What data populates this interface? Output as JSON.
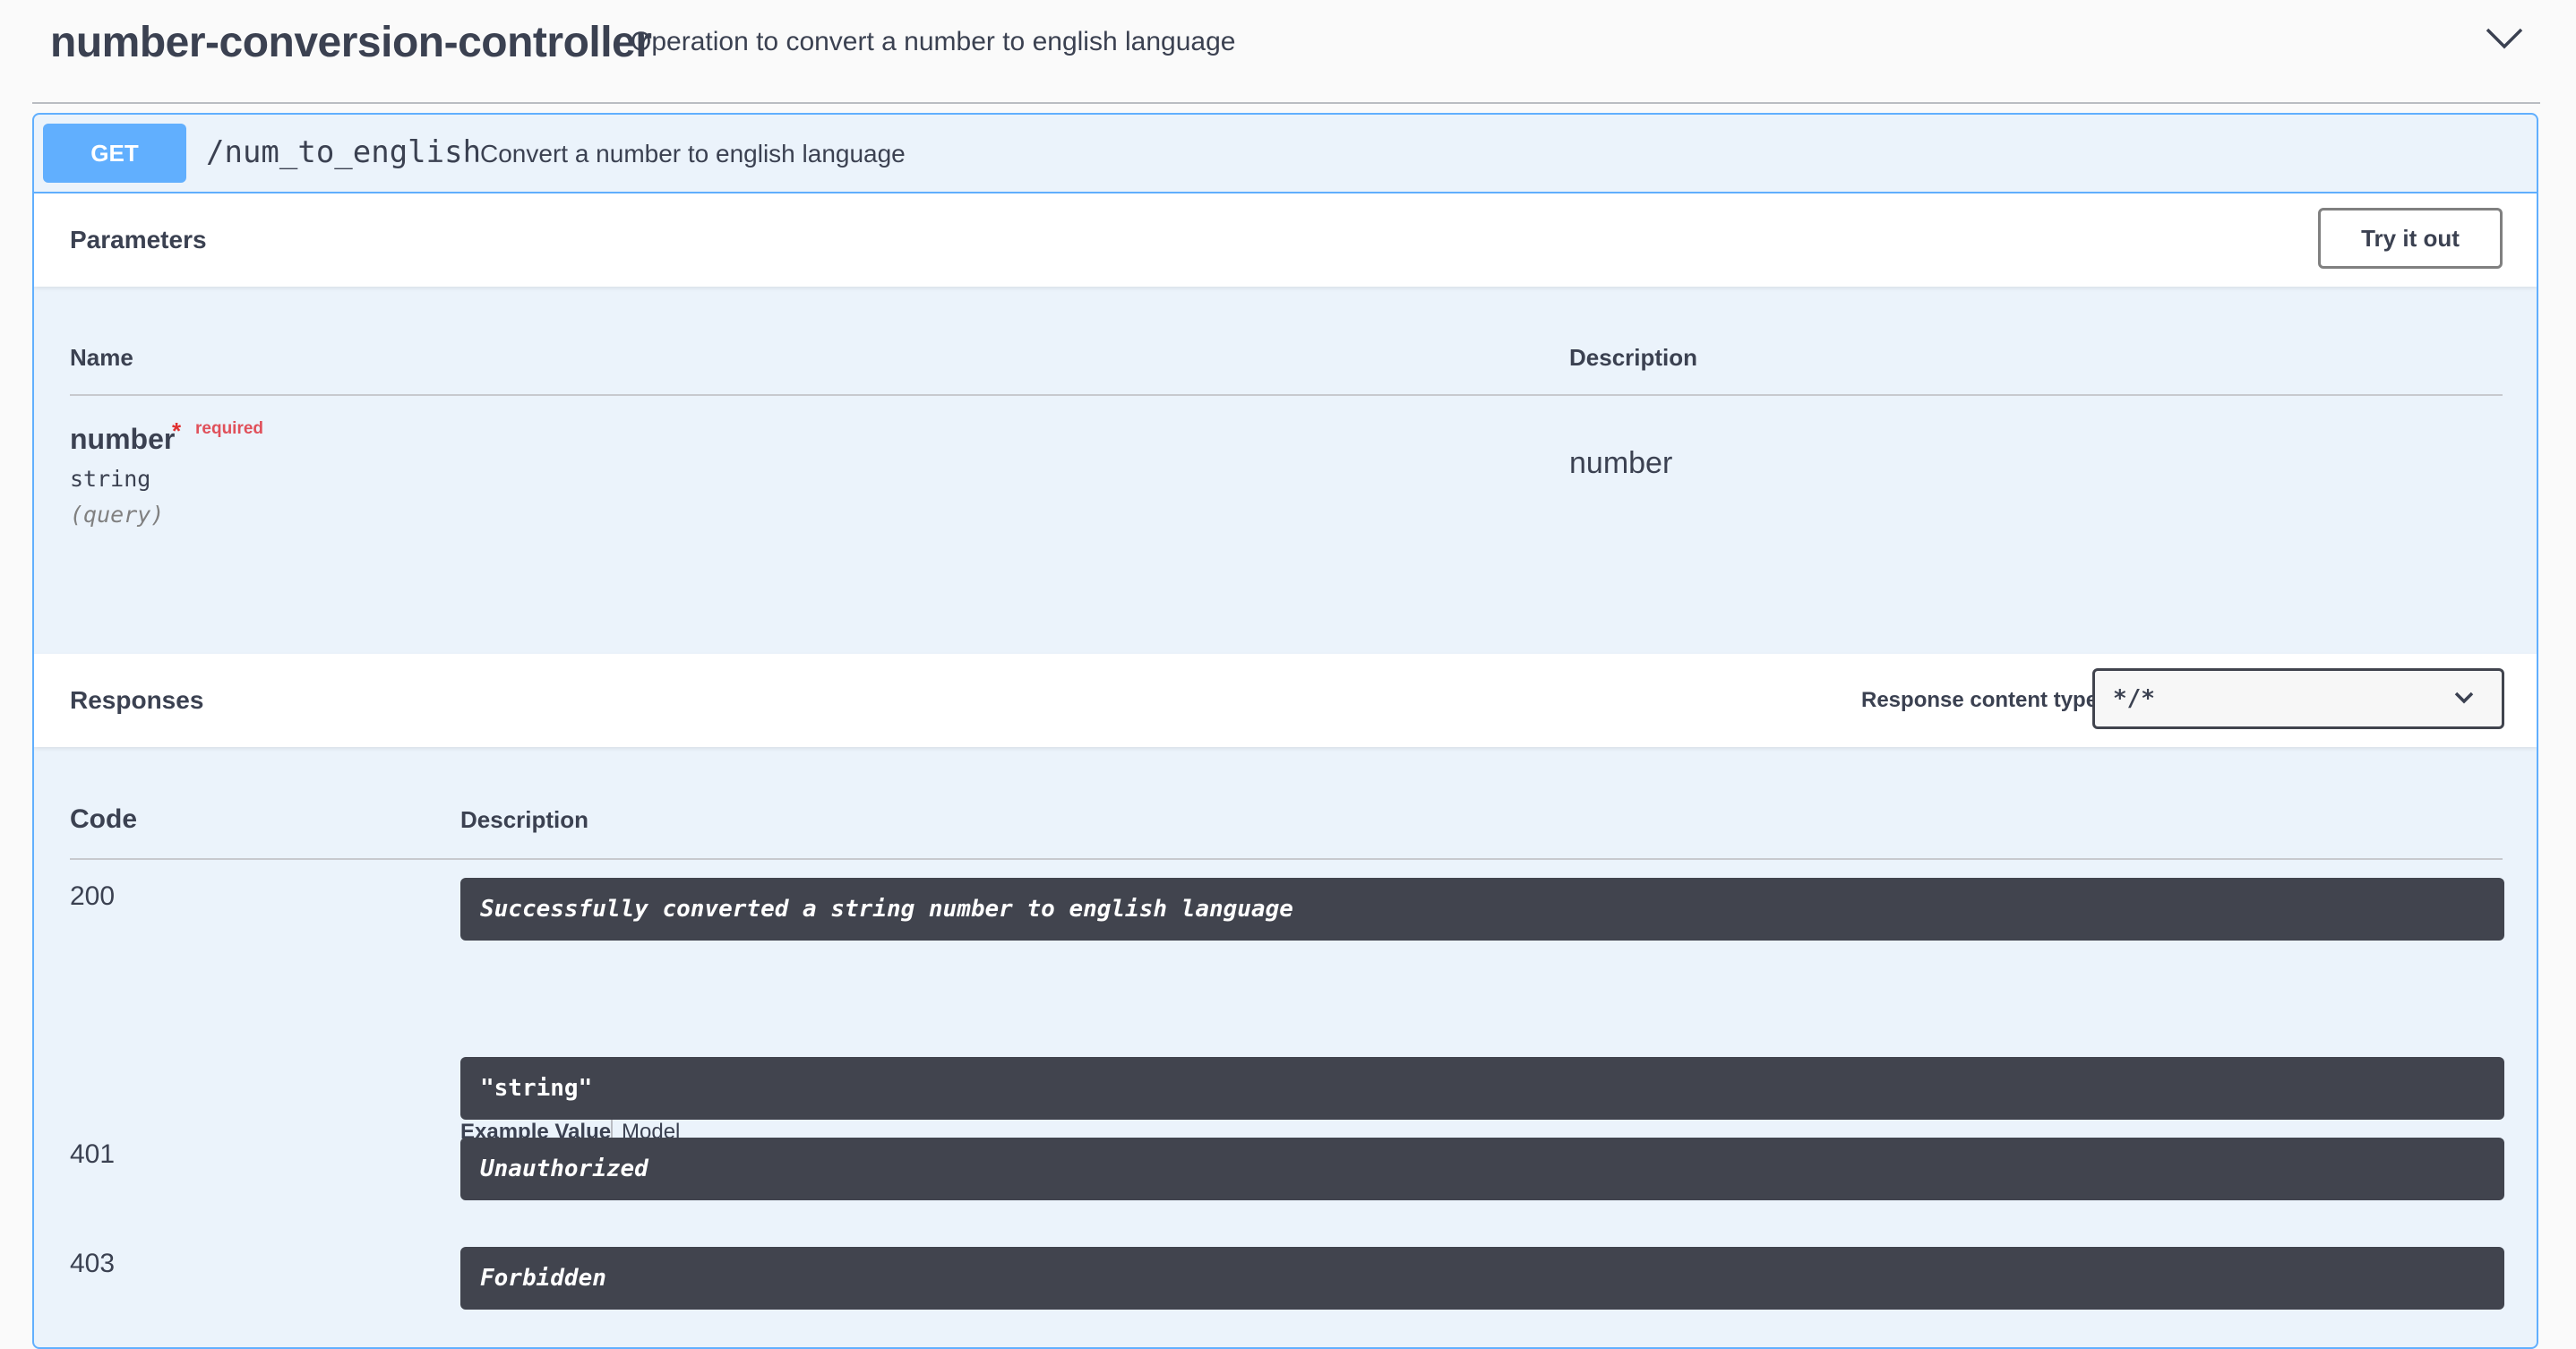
{
  "tag": {
    "title": "number-conversion-controller",
    "description": "Operation to convert a number to english language"
  },
  "operation": {
    "method": "GET",
    "path": "/num_to_english",
    "summary": "Convert a number to english language"
  },
  "parameters": {
    "title": "Parameters",
    "try_label": "Try it out",
    "col_name": "Name",
    "col_description": "Description",
    "items": [
      {
        "name": "number",
        "star": "*",
        "required_label": "required",
        "type": "string",
        "in": "(query)",
        "description": "number"
      }
    ]
  },
  "responses": {
    "title": "Responses",
    "content_type_label": "Response content type",
    "content_type_value": "*/*",
    "col_code": "Code",
    "col_description": "Description",
    "example_tab": "Example Value",
    "model_tab": "Model",
    "items": [
      {
        "code": "200",
        "description": "Successfully converted a string number to english language",
        "example": "\"string\""
      },
      {
        "code": "401",
        "description": "Unauthorized"
      },
      {
        "code": "403",
        "description": "Forbidden"
      }
    ]
  },
  "colors": {
    "get_method": "#61affe",
    "opblock_bg": "#ebf3fb",
    "dark_block": "#41444e",
    "required": "#e0505a"
  }
}
